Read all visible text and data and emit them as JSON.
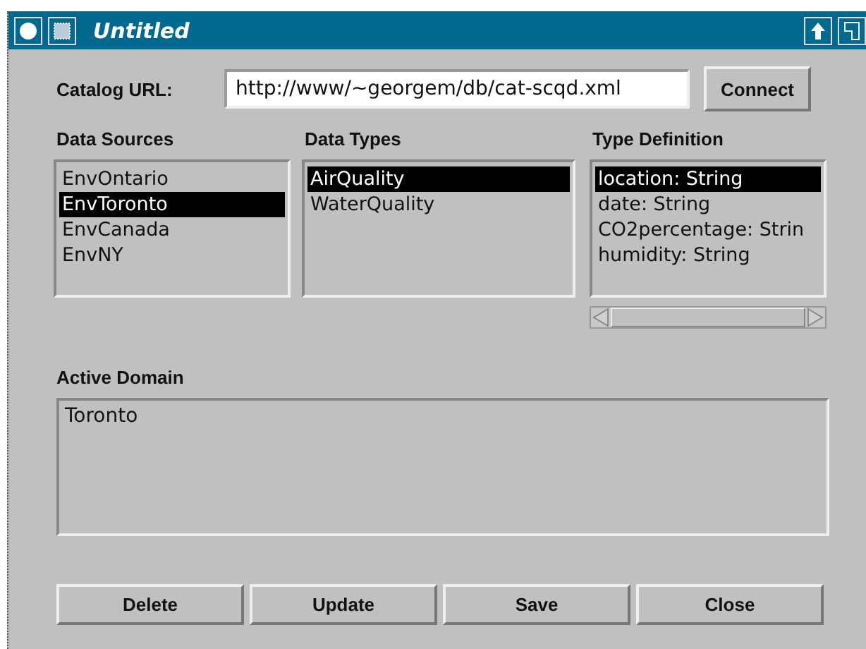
{
  "window": {
    "title": "Untitled"
  },
  "catalog": {
    "label": "Catalog URL:",
    "value": "http://www/~georgem/db/cat-scqd.xml",
    "button": "Connect"
  },
  "lists": [
    {
      "header": "Data Sources",
      "items": [
        {
          "label": "EnvOntario",
          "selected": false
        },
        {
          "label": "EnvToronto",
          "selected": true
        },
        {
          "label": "EnvCanada",
          "selected": false
        },
        {
          "label": "EnvNY",
          "selected": false
        }
      ]
    },
    {
      "header": "Data Types",
      "items": [
        {
          "label": "AirQuality",
          "selected": true
        },
        {
          "label": "WaterQuality",
          "selected": false
        }
      ]
    },
    {
      "header": "Type Definition",
      "items": [
        {
          "label": "location: String",
          "selected": true
        },
        {
          "label": "date: String",
          "selected": false
        },
        {
          "label": "CO2percentage: Strin",
          "selected": false
        },
        {
          "label": "humidity: String",
          "selected": false
        }
      ]
    }
  ],
  "active_domain": {
    "header": "Active Domain",
    "value": "Toronto"
  },
  "buttons": [
    "Delete",
    "Update",
    "Save",
    "Close"
  ]
}
